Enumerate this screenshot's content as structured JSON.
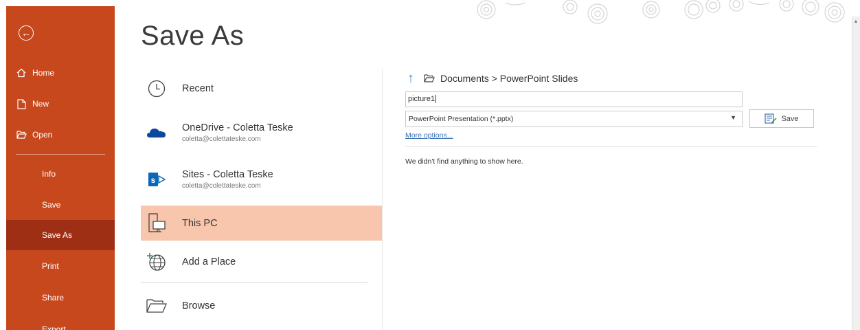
{
  "nav": {
    "back_icon": "back-arrow-circle-icon",
    "items": [
      {
        "label": "Home",
        "icon": "home-icon"
      },
      {
        "label": "New",
        "icon": "new-document-icon"
      },
      {
        "label": "Open",
        "icon": "open-folder-icon"
      },
      {
        "label": "Info"
      },
      {
        "label": "Save"
      },
      {
        "label": "Save As",
        "active": true
      },
      {
        "label": "Print"
      },
      {
        "label": "Share"
      },
      {
        "label": "Export"
      }
    ]
  },
  "page": {
    "title": "Save As"
  },
  "locations": [
    {
      "name": "Recent",
      "sub": "",
      "icon": "clock-icon"
    },
    {
      "name": "OneDrive - Coletta Teske",
      "sub": "coletta@colettateske.com",
      "icon": "onedrive-cloud-icon"
    },
    {
      "name": "Sites - Coletta Teske",
      "sub": "coletta@colettateske.com",
      "icon": "sharepoint-icon"
    },
    {
      "name": "This PC",
      "sub": "",
      "icon": "this-pc-icon",
      "selected": true
    },
    {
      "name": "Add a Place",
      "sub": "",
      "icon": "add-place-globe-icon"
    },
    {
      "name": "Browse",
      "sub": "",
      "icon": "browse-folder-icon"
    }
  ],
  "save_panel": {
    "breadcrumb": "Documents > PowerPoint Slides",
    "filename_value": "picture1",
    "filetype_value": "PowerPoint Presentation (*.pptx)",
    "save_label": "Save",
    "more_options": "More options...",
    "empty_message": "We didn't find anything to show here."
  },
  "colors": {
    "sidebar": "#c8481d",
    "sidebar_active": "#9e2f15",
    "selected_location": "#f8c6ad",
    "link": "#3a6fb0",
    "up_arrow": "#3f8fd6"
  }
}
